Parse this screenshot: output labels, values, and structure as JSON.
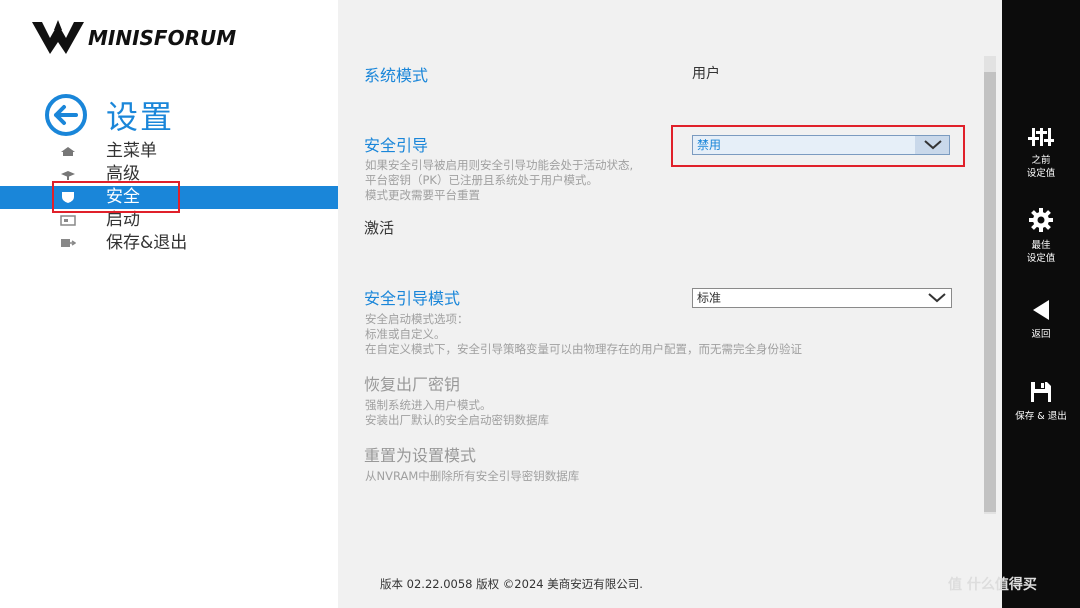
{
  "brand": {
    "name": "MINISFORUM"
  },
  "header": {
    "title": "设置"
  },
  "nav": [
    {
      "label": "主菜单",
      "icon": "home-icon",
      "active": false
    },
    {
      "label": "高级",
      "icon": "advanced-icon",
      "active": false
    },
    {
      "label": "安全",
      "icon": "shield-icon",
      "active": true
    },
    {
      "label": "启动",
      "icon": "boot-icon",
      "active": false
    },
    {
      "label": "保存&退出",
      "icon": "save-exit-icon",
      "active": false
    }
  ],
  "settings": {
    "system_mode": {
      "label": "系统模式",
      "value": "用户"
    },
    "secure_boot": {
      "label": "安全引导",
      "value": "禁用",
      "desc": [
        "如果安全引导被启用则安全引导功能会处于活动状态,",
        "平台密钥（PK）已注册且系统处于用户模式。",
        "模式更改需要平台重置"
      ],
      "state": "激活"
    },
    "secure_boot_mode": {
      "label": "安全引导模式",
      "value": "标准",
      "desc": [
        "安全启动模式选项：",
        "标准或自定义。",
        "在自定义模式下，安全引导策略变量可以由物理存在的用户配置，而无需完全身份验证"
      ]
    },
    "restore_keys": {
      "label": "恢复出厂密钥",
      "desc": [
        "强制系统进入用户模式。",
        "安装出厂默认的安全启动密钥数据库"
      ]
    },
    "reset_setup": {
      "label": "重置为设置模式",
      "desc": [
        "从NVRAM中删除所有安全引导密钥数据库"
      ]
    }
  },
  "footer": {
    "text": "版本 02.22.0058 版权 ©2024 美商安迈有限公司."
  },
  "actions": [
    {
      "label1": "之前",
      "label2": "设定值",
      "icon": "sliders-icon"
    },
    {
      "label1": "最佳",
      "label2": "设定值",
      "icon": "gear-icon"
    },
    {
      "label1": "返回",
      "label2": "",
      "icon": "back-arrow-icon"
    },
    {
      "label1": "保存 & 退出",
      "label2": "",
      "icon": "floppy-icon"
    }
  ],
  "watermark": "值 什么值得买",
  "colors": {
    "accent": "#1a86d9",
    "highlight": "#e0202a",
    "sidebar": "#0c0c0c"
  }
}
